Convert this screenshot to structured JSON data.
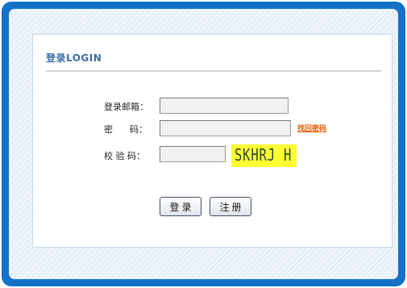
{
  "form": {
    "title": "登录LOGIN",
    "email_label": "登录邮箱：",
    "email_value": "",
    "password_label": "密      码：",
    "password_value": "",
    "forgot_link": "找回密码",
    "captcha_label": "校 验 码：",
    "captcha_value": "",
    "captcha_image_text": "SKHRJ H",
    "login_button": "登录",
    "register_button": "注册"
  },
  "colors": {
    "frame": "#1272c7",
    "title": "#3a6fa8",
    "forgot_link": "#e05a00",
    "captcha_background": "#ffff33"
  }
}
